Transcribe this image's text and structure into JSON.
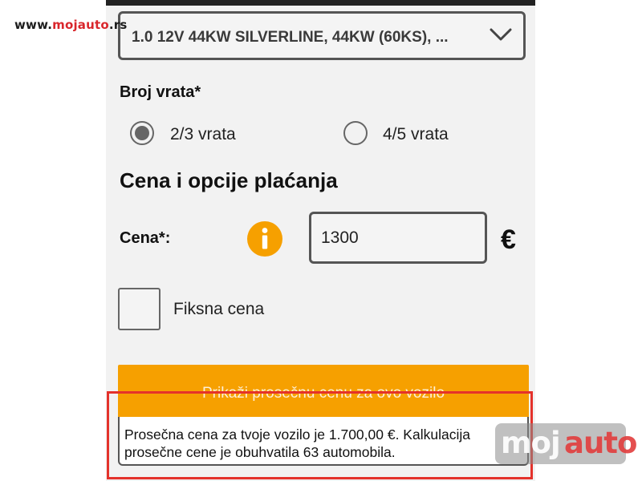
{
  "watermark": {
    "site_prefix": "www.",
    "site_accent": "mojauto",
    "site_suffix": ".rs",
    "logo_part1": "moj",
    "logo_part2": "auto"
  },
  "engine_select": {
    "value": "1.0 12V 44KW SILVERLINE, 44KW (60KS), ...",
    "icon": "chevron-down-icon"
  },
  "doors": {
    "label": "Broj vrata*",
    "options": [
      {
        "label": "2/3 vrata",
        "selected": true
      },
      {
        "label": "4/5 vrata",
        "selected": false
      }
    ]
  },
  "price_section": {
    "title": "Cena i opcije plaćanja",
    "price_label": "Cena*:",
    "info_icon": "info-icon",
    "price_value": "1300",
    "currency": "€",
    "fixed_price_label": "Fiksna cena",
    "fixed_price_checked": false,
    "average_button_label": "Prikaži prosečnu cenu za ovo vozilo",
    "average_result": "Prosečna cena za tvoje vozilo je 1.700,00 €. Kalkulacija prosečne cene je obuhvatila 63 automobila."
  },
  "colors": {
    "accent": "#f6a000",
    "highlight": "#e4322b",
    "border": "#555555"
  }
}
